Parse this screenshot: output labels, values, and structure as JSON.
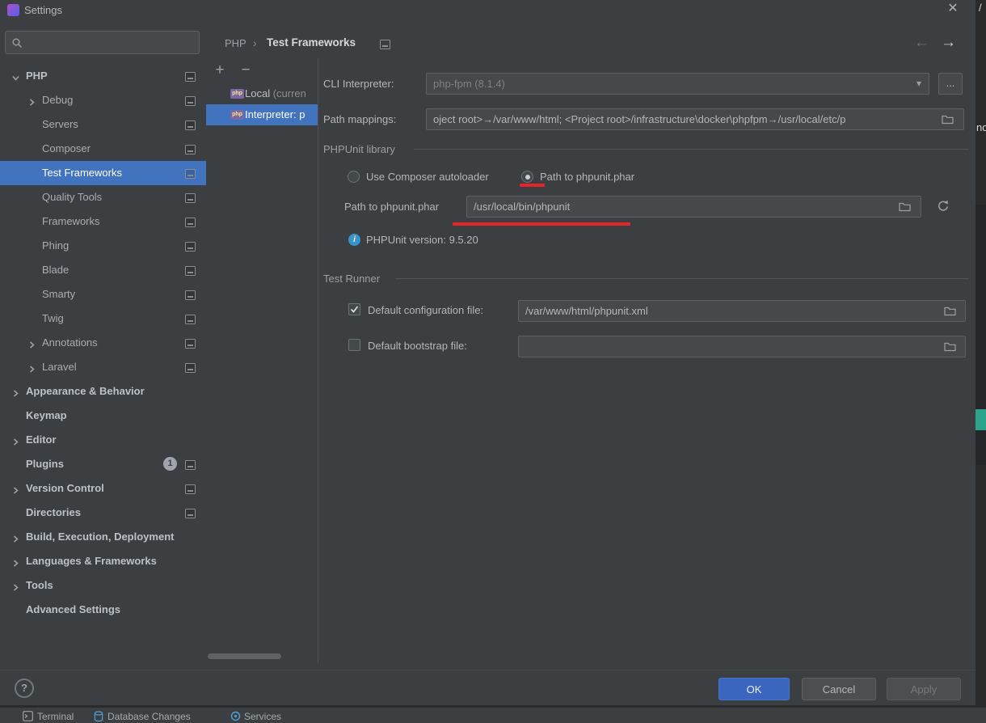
{
  "window": {
    "title": "Settings",
    "close_glyph": "✕"
  },
  "sidebar": {
    "tree": [
      {
        "label": "PHP",
        "level": 0,
        "bold": true,
        "chevron": "down",
        "marker": true
      },
      {
        "label": "Debug",
        "level": 1,
        "chevron": "right",
        "marker": true
      },
      {
        "label": "Servers",
        "level": 1,
        "marker": true
      },
      {
        "label": "Composer",
        "level": 1,
        "marker": true
      },
      {
        "label": "Test Frameworks",
        "level": 1,
        "selected": true,
        "marker": true
      },
      {
        "label": "Quality Tools",
        "level": 1,
        "marker": true
      },
      {
        "label": "Frameworks",
        "level": 1,
        "marker": true
      },
      {
        "label": "Phing",
        "level": 1,
        "marker": true
      },
      {
        "label": "Blade",
        "level": 1,
        "marker": true
      },
      {
        "label": "Smarty",
        "level": 1,
        "marker": true
      },
      {
        "label": "Twig",
        "level": 1,
        "marker": true
      },
      {
        "label": "Annotations",
        "level": 1,
        "chevron": "right",
        "marker": true
      },
      {
        "label": "Laravel",
        "level": 1,
        "chevron": "right",
        "marker": true
      },
      {
        "label": "Appearance & Behavior",
        "level": 0,
        "bold": true,
        "chevron": "right"
      },
      {
        "label": "Keymap",
        "level": 0,
        "bold": true
      },
      {
        "label": "Editor",
        "level": 0,
        "bold": true,
        "chevron": "right"
      },
      {
        "label": "Plugins",
        "level": 0,
        "bold": true,
        "badge": "1",
        "marker": true
      },
      {
        "label": "Version Control",
        "level": 0,
        "bold": true,
        "chevron": "right",
        "marker": true
      },
      {
        "label": "Directories",
        "level": 0,
        "bold": true,
        "marker": true
      },
      {
        "label": "Build, Execution, Deployment",
        "level": 0,
        "bold": true,
        "chevron": "right"
      },
      {
        "label": "Languages & Frameworks",
        "level": 0,
        "bold": true,
        "chevron": "right"
      },
      {
        "label": "Tools",
        "level": 0,
        "bold": true,
        "chevron": "right"
      },
      {
        "label": "Advanced Settings",
        "level": 0,
        "bold": true
      }
    ]
  },
  "breadcrumb": {
    "root": "PHP",
    "separator": "›",
    "current": "Test Frameworks"
  },
  "nav": {
    "back": "←",
    "forward": "→"
  },
  "interpreter_panel": {
    "add": "+",
    "remove": "−",
    "items": [
      {
        "label": "Local",
        "suffix": " (curren",
        "selected": false
      },
      {
        "label": "Interpreter: p",
        "suffix": "",
        "selected": true
      }
    ]
  },
  "form": {
    "cli_interpreter_label": "CLI Interpreter:",
    "cli_interpreter_value": "php-fpm (8.1.4)",
    "more_button": "...",
    "combo_arrow": "▾",
    "path_mappings_label": "Path mappings:",
    "path_mappings_value": "oject root>→/var/www/html; <Project root>/infrastructure\\docker\\phpfpm→/usr/local/etc/p",
    "phpunit_section": "PHPUnit library",
    "radio_composer": "Use Composer autoloader",
    "radio_phar": "Path to phpunit.phar",
    "phar_path_label": "Path to phpunit.phar",
    "phar_path_value": "/usr/local/bin/phpunit",
    "version_info": "PHPUnit version: 9.5.20",
    "info_glyph": "i",
    "test_runner_section": "Test Runner",
    "config_checkbox_label": "Default configuration file:",
    "config_value": "/var/www/html/phpunit.xml",
    "bootstrap_checkbox_label": "Default bootstrap file:",
    "bootstrap_value": ""
  },
  "footer": {
    "help": "?",
    "ok": "OK",
    "cancel": "Cancel",
    "apply": "Apply"
  },
  "statusbar": {
    "items": [
      "Terminal",
      "Database Changes",
      "Services"
    ]
  },
  "background": {
    "top_right_fragment": "/",
    "mid_right_fragment": "nd"
  }
}
